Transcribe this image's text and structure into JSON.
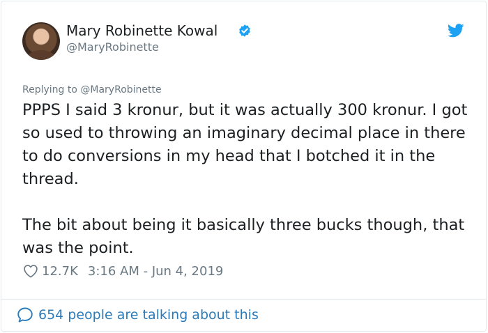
{
  "author": {
    "name": "Mary Robinette Kowal",
    "handle": "@MaryRobinette",
    "verified": true
  },
  "tweet": {
    "replying_to_prefix": "Replying to ",
    "replying_to_handle": "@MaryRobinette",
    "text": "PPPS I said 3 kronur, but it was actually 300 kronur. I got so used to throwing an imaginary decimal place in there to do conversions in my head that I botched it in the thread.\n\nThe bit about being it basically three bucks though, that was the point.",
    "likes": "12.7K",
    "timestamp": "3:16 AM - Jun 4, 2019"
  },
  "footer": {
    "talking_text": "654 people are talking about this"
  },
  "icons": {
    "verified": "verified-badge-icon",
    "brand": "twitter-bird-icon",
    "like": "heart-icon",
    "conversation": "speech-bubble-icon"
  },
  "colors": {
    "brand_blue": "#1da1f2",
    "link_blue": "#2b7bb9",
    "muted_gray": "#697882",
    "text_dark": "#1c2022",
    "border": "#e1e8ed"
  }
}
